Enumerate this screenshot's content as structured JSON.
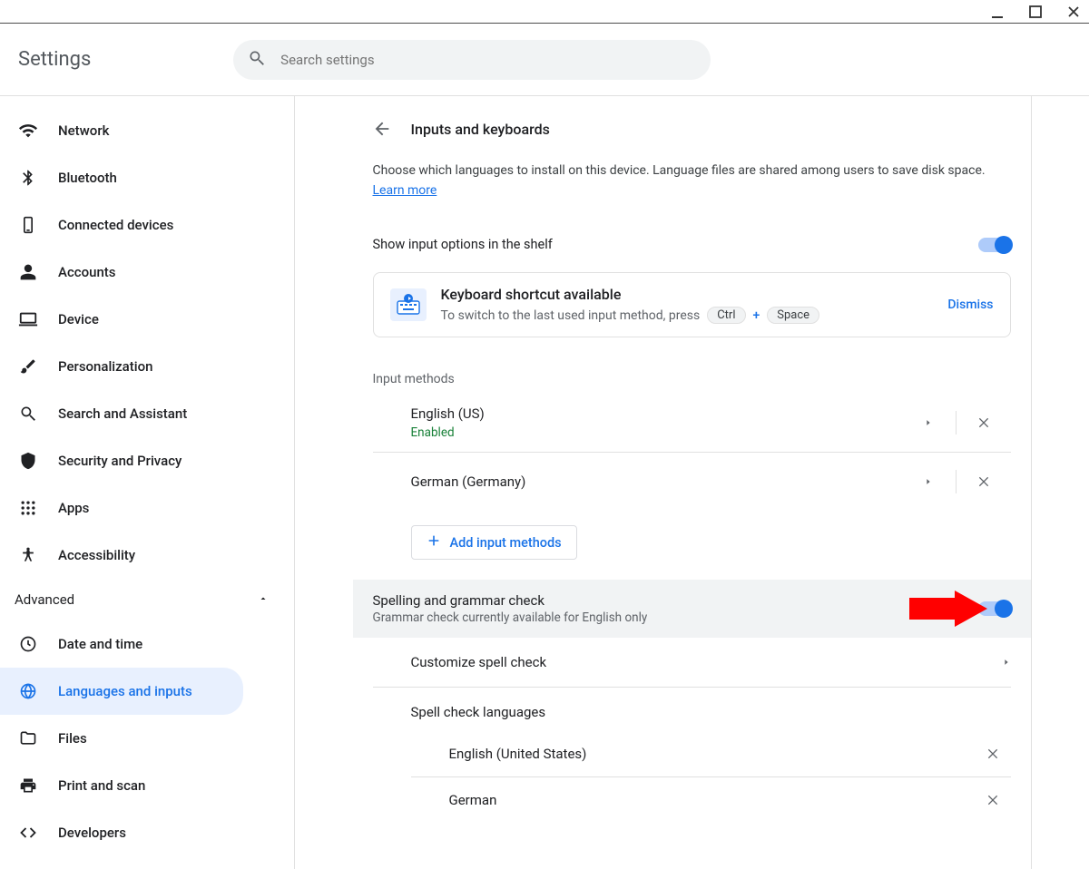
{
  "window": {},
  "app": {
    "title": "Settings"
  },
  "search": {
    "placeholder": "Search settings"
  },
  "sidebar": {
    "items": [
      {
        "label": "Network"
      },
      {
        "label": "Bluetooth"
      },
      {
        "label": "Connected devices"
      },
      {
        "label": "Accounts"
      },
      {
        "label": "Device"
      },
      {
        "label": "Personalization"
      },
      {
        "label": "Search and Assistant"
      },
      {
        "label": "Security and Privacy"
      },
      {
        "label": "Apps"
      },
      {
        "label": "Accessibility"
      }
    ],
    "advanced": {
      "label": "Advanced"
    },
    "adv_items": [
      {
        "label": "Date and time"
      },
      {
        "label": "Languages and inputs"
      },
      {
        "label": "Files"
      },
      {
        "label": "Print and scan"
      },
      {
        "label": "Developers"
      }
    ]
  },
  "page": {
    "title": "Inputs and keyboards",
    "intro": "Choose which languages to install on this device. Language files are shared among users to save disk space.",
    "learn_more": "Learn more",
    "row_shelf": "Show input options in the shelf"
  },
  "kb": {
    "title": "Keyboard shortcut available",
    "desc": "To switch to the last used input method, press",
    "key1": "Ctrl",
    "plus": "+",
    "key2": "Space",
    "dismiss": "Dismiss"
  },
  "input_methods": {
    "label": "Input methods",
    "items": [
      {
        "name": "English (US)",
        "status": "Enabled"
      },
      {
        "name": "German (Germany)",
        "status": ""
      }
    ],
    "add": "Add input methods"
  },
  "spell": {
    "title": "Spelling and grammar check",
    "sub": "Grammar check currently available for English only",
    "customize": "Customize spell check",
    "langs_label": "Spell check languages",
    "langs": [
      {
        "name": "English (United States)"
      },
      {
        "name": "German"
      }
    ]
  }
}
